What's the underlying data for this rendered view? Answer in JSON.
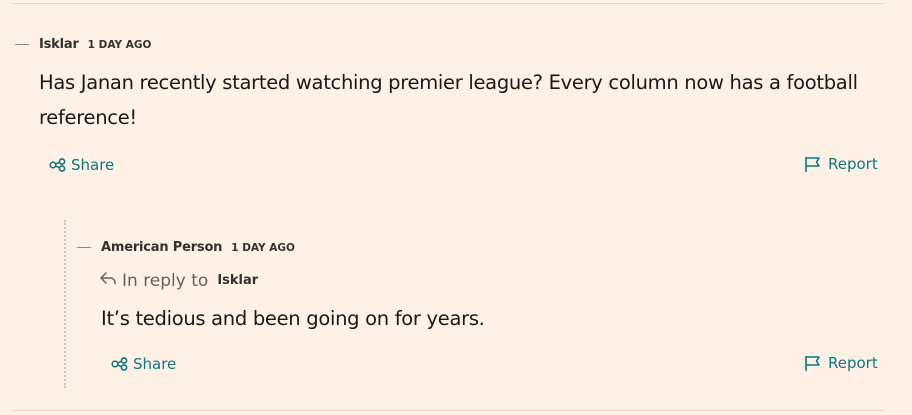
{
  "comments": [
    {
      "author": "Isklar",
      "time": "1 DAY AGO",
      "body": "Has Janan recently started watching premier league? Every column now has a football reference!",
      "share_label": "Share",
      "report_label": "Report"
    },
    {
      "author": "American Person",
      "time": "1 DAY AGO",
      "reply_prefix": "In reply to",
      "reply_to": "Isklar",
      "body": "It’s tedious and been going on for years.",
      "share_label": "Share",
      "report_label": "Report"
    }
  ],
  "colors": {
    "background": "#fff1e5",
    "accent": "#0d7680",
    "text": "#1a1817"
  },
  "icons": [
    "collapse-icon",
    "share-icon",
    "flag-icon",
    "reply-arrow-icon"
  ]
}
